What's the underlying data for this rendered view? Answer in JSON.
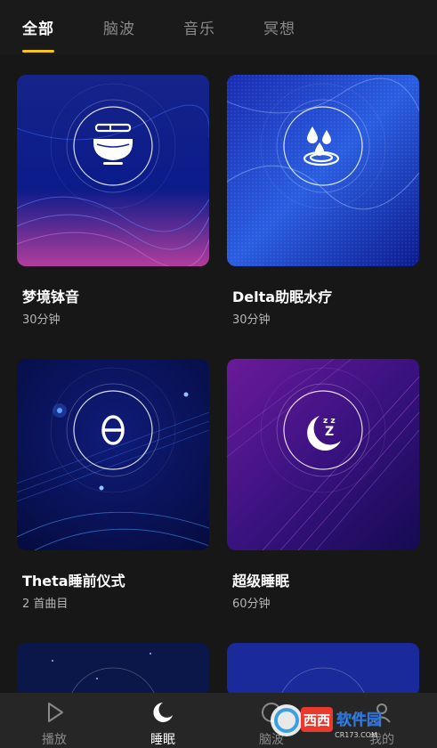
{
  "tabs": [
    {
      "label": "全部",
      "active": true
    },
    {
      "label": "脑波",
      "active": false
    },
    {
      "label": "音乐",
      "active": false
    },
    {
      "label": "冥想",
      "active": false
    }
  ],
  "cards": [
    {
      "title": "梦境钵音",
      "subtitle": "30分钟",
      "icon": "singing-bowl-icon"
    },
    {
      "title": "Delta助眠水疗",
      "subtitle": "30分钟",
      "icon": "water-drops-icon"
    },
    {
      "title": "Theta睡前仪式",
      "subtitle": "2 首曲目",
      "icon": "theta-icon"
    },
    {
      "title": "超级睡眠",
      "subtitle": "60分钟",
      "icon": "moon-zzz-icon"
    },
    {
      "title": "",
      "subtitle": "",
      "icon": ""
    },
    {
      "title": "",
      "subtitle": "",
      "icon": ""
    }
  ],
  "bottom_nav": [
    {
      "label": "播放",
      "icon": "play-icon",
      "active": false
    },
    {
      "label": "睡眠",
      "icon": "moon-icon",
      "active": true
    },
    {
      "label": "脑波",
      "icon": "brainwave-icon",
      "active": false
    },
    {
      "label": "我的",
      "icon": "profile-icon",
      "active": false
    }
  ],
  "watermark": {
    "brand": "西西",
    "text": "软件园",
    "url": "CR173.COM"
  },
  "colors": {
    "accent": "#f5c518",
    "background": "#171717",
    "nav_bg": "#262626"
  }
}
